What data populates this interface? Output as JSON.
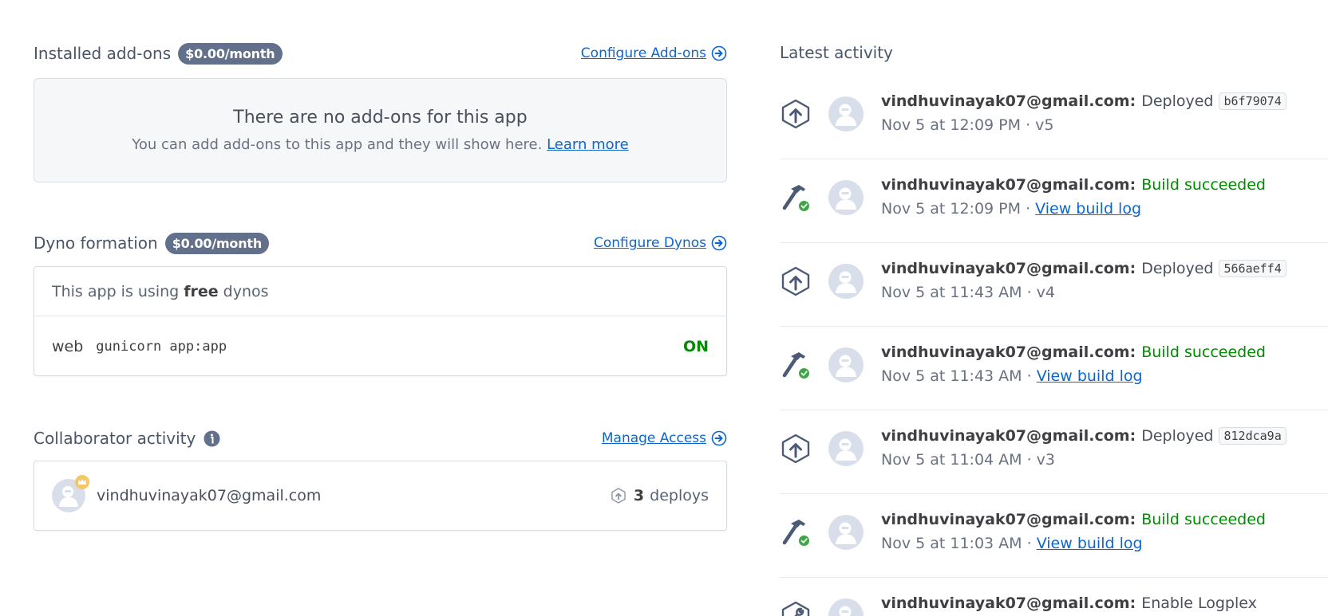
{
  "addons": {
    "title": "Installed add-ons",
    "price": "$0.00/month",
    "configure_label": "Configure Add-ons",
    "empty_title": "There are no add-ons for this app",
    "empty_text": "You can add add-ons to this app and they will show here.",
    "learn_more": "Learn more"
  },
  "dynos": {
    "title": "Dyno formation",
    "price": "$0.00/month",
    "configure_label": "Configure Dynos",
    "plan_prefix": "This app is using",
    "plan_type": "free",
    "plan_suffix": "dynos",
    "process": {
      "type": "web",
      "command": "gunicorn app:app",
      "state": "ON"
    }
  },
  "collaborators": {
    "title": "Collaborator activity",
    "manage_label": "Manage Access",
    "items": [
      {
        "email": "vindhuvinayak07@gmail.com",
        "deploy_count": "3",
        "deploy_label": "deploys"
      }
    ]
  },
  "activity": {
    "title": "Latest activity",
    "items": [
      {
        "kind": "deploy",
        "user": "vindhuvinayak07@gmail.com:",
        "action": "Deployed",
        "commit": "b6f79074",
        "time": "Nov 5 at 12:09 PM · v5"
      },
      {
        "kind": "build",
        "user": "vindhuvinayak07@gmail.com:",
        "action": "Build succeeded",
        "time": "Nov 5 at 12:09 PM ·",
        "link": "View build log"
      },
      {
        "kind": "deploy",
        "user": "vindhuvinayak07@gmail.com:",
        "action": "Deployed",
        "commit": "566aeff4",
        "time": "Nov 5 at 11:43 AM · v4"
      },
      {
        "kind": "build",
        "user": "vindhuvinayak07@gmail.com:",
        "action": "Build succeeded",
        "time": "Nov 5 at 11:43 AM ·",
        "link": "View build log"
      },
      {
        "kind": "deploy",
        "user": "vindhuvinayak07@gmail.com:",
        "action": "Deployed",
        "commit": "812dca9a",
        "time": "Nov 5 at 11:04 AM · v3"
      },
      {
        "kind": "build",
        "user": "vindhuvinayak07@gmail.com:",
        "action": "Build succeeded",
        "time": "Nov 5 at 11:03 AM ·",
        "link": "View build log"
      },
      {
        "kind": "config",
        "user": "vindhuvinayak07@gmail.com:",
        "action": "Enable Logplex"
      }
    ]
  },
  "colors": {
    "link": "#0e66cc",
    "success": "#008a00",
    "badge": "#62708b",
    "icon": "#4d5a75"
  }
}
